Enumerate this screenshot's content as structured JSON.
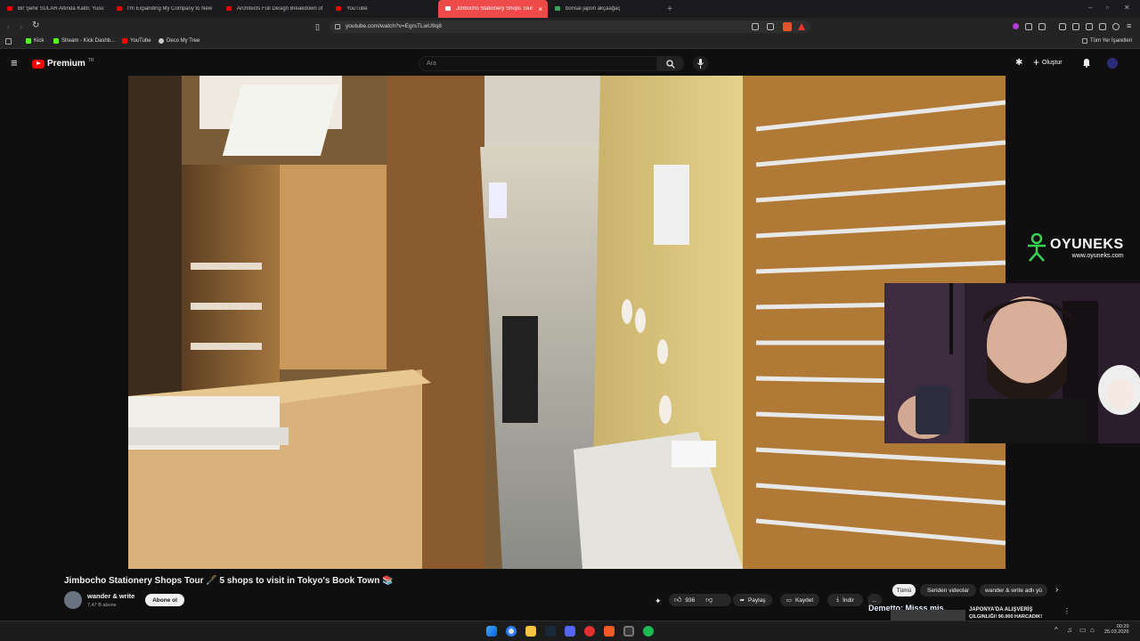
{
  "browser": {
    "tabs": [
      {
        "title": "Bir Şehir SULAR Altında Kaldı; Yusufe",
        "favicon": "youtube-icon"
      },
      {
        "title": "I'm Expanding My Company to New",
        "favicon": "youtube-icon"
      },
      {
        "title": "Architects Full Design Breakdown of",
        "favicon": "youtube-icon"
      },
      {
        "title": "YouTube",
        "favicon": "youtube-icon"
      },
      {
        "title": "Jimbocho Stationery Shops Tour",
        "favicon": "youtube-icon",
        "active": true
      },
      {
        "title": "bonsai japon akçaağaç",
        "favicon": "sheets-icon"
      }
    ],
    "new_tab": "+",
    "url": "youtube.com/watch?v=EgrsTLwU9q8",
    "bookmarks": [
      "Kick",
      "Stream - Kick Dashb...",
      "YouTube",
      "Deco My Tree"
    ],
    "all_bookmarks": "Tüm Yer İşaretleri"
  },
  "youtube": {
    "logo": "Premium",
    "region": "TR",
    "search_placeholder": "Ara",
    "create_label": "Oluştur",
    "video_title": "Jimbocho Stationery Shops Tour 🖋️ 5 shops to visit in Tokyo's Book Town 📚",
    "channel_name": "wander & write",
    "subscribers": "7,47 B abone",
    "subscribe_label": "Abone ol",
    "likes": "936",
    "share_label": "Paylaş",
    "save_label": "Kaydet",
    "download_label": "İndir",
    "more_label": "...",
    "chips": [
      "Tümü",
      "Seriden videolar",
      "wander & write adlı yü"
    ]
  },
  "overlay": {
    "brand": "OYUNEKS",
    "brand_url": "www.oyuneks.com",
    "chat_text": "Demetto: Misss mis",
    "recommendation_title": "JAPONYA'DA ALIŞVERİŞ",
    "recommendation_sub": "ÇILGINLIĞI! 90.000 HARCADIK!"
  },
  "taskbar": {
    "time": "00:20",
    "date": "25.03.2026"
  },
  "colors": {
    "youtube_red": "#ff0000",
    "active_tab": "#ef4a4a",
    "brand_green": "#39d353"
  }
}
